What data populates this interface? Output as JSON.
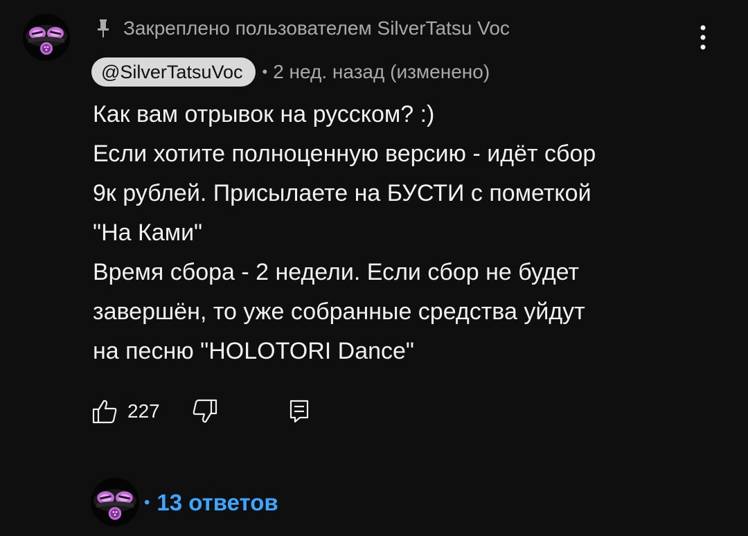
{
  "pinned": {
    "icon": "pin-icon",
    "text": "Закреплено пользователем SilverTatsu Voc"
  },
  "more_icon": "more-vertical-icon",
  "comment": {
    "author": "@SilverTatsuVoc",
    "separator": "•",
    "time": "2 нед. назад (изменено)",
    "lines": [
      "Как вам отрывок на русском? :)",
      "Если хотите полноценную версию - идёт сбор",
      "9к рублей. Присылаете на БУСТИ с пометкой",
      "\"На Ками\"",
      "Время сбора - 2 недели. Если сбор не будет",
      "завершён, то уже собранные средства уйдут",
      "на песню \"HOLOTORI Dance\""
    ]
  },
  "actions": {
    "like_icon": "thumb-up-icon",
    "like_count": "227",
    "dislike_icon": "thumb-down-icon",
    "reply_icon": "comment-icon"
  },
  "replies": {
    "separator": "•",
    "label": "13 ответов"
  },
  "colors": {
    "background": "#0f0f0f",
    "text": "#f1f1f1",
    "secondary_text": "#aaaaaa",
    "link": "#3ea6ff",
    "author_chip": "#d9d9d9",
    "avatar_accent": "#c26bd6"
  }
}
